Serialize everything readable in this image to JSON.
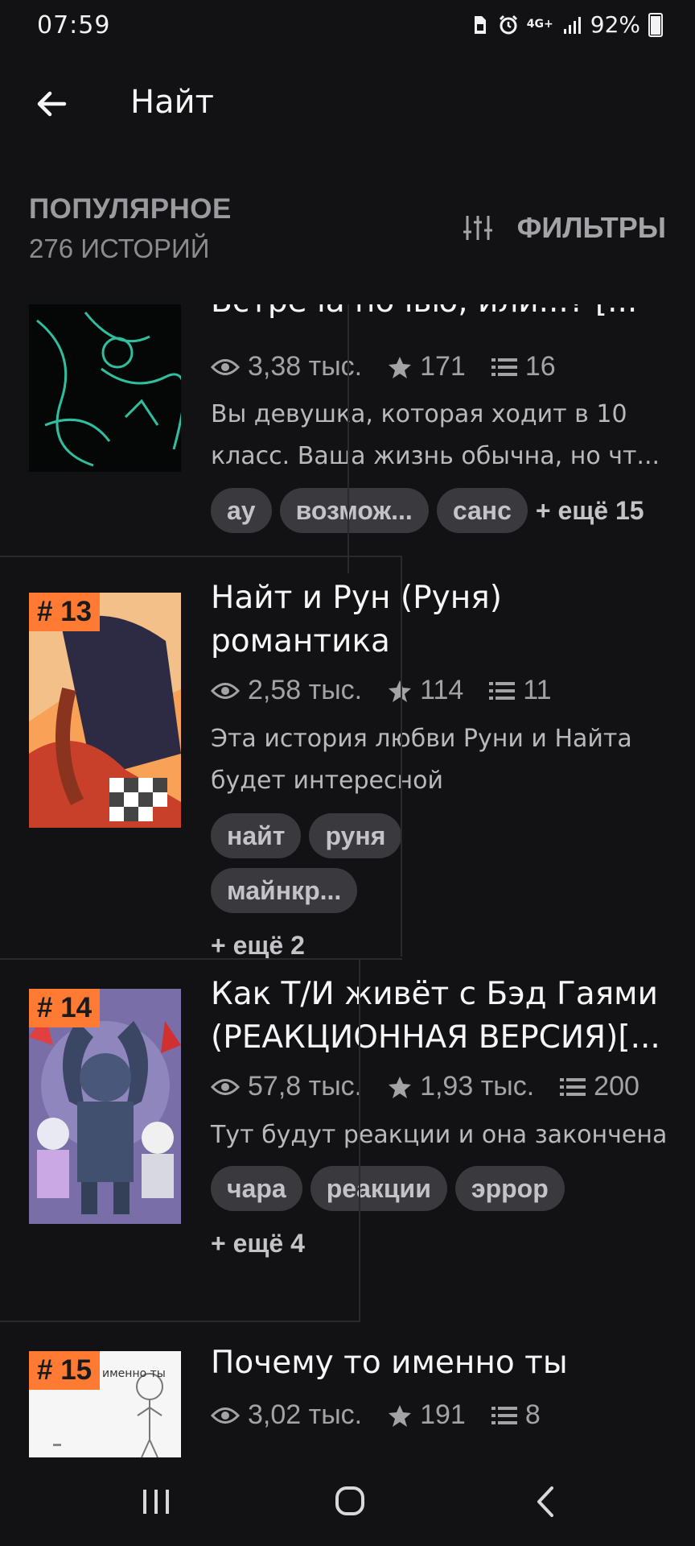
{
  "status_bar": {
    "time": "07:59",
    "network": "4G+",
    "battery": "92%",
    "icons": [
      "sim-icon",
      "alarm-icon",
      "signal-icon",
      "battery-icon"
    ]
  },
  "app_bar": {
    "title": "Найт",
    "back_icon": "arrow-left-icon"
  },
  "section": {
    "title": "ПОПУЛЯРНОЕ",
    "count": "276 ИСТОРИЙ",
    "filters_label": "ФИЛЬТРЫ",
    "filters_icon": "sliders-icon"
  },
  "stories": [
    {
      "rank": "",
      "title": "Встреча ночью, или...? [...",
      "views": "3,38 тыс.",
      "stars": "171",
      "parts": "16",
      "description": [
        "Вы девушка, которая ходит в 10",
        "класс. Ваша жизнь обычна, но чт..."
      ],
      "tags": [
        "ау",
        "возмож...",
        "санс"
      ],
      "more": "+ ещё 15"
    },
    {
      "rank": "# 13",
      "title": [
        "Найт и Рун (Руня)",
        "романтика"
      ],
      "views": "2,58 тыс.",
      "stars": "114",
      "parts": "11",
      "description": [
        "Эта история любви Руни и Найта",
        "будет интересной"
      ],
      "tags": [
        "найт",
        "руня",
        "майнкр..."
      ],
      "more": "+ ещё 2"
    },
    {
      "rank": "# 14",
      "title": [
        "Как Т/И живёт с Бэд Гаями",
        "(РЕАКЦИОННАЯ ВЕРСИЯ)[..."
      ],
      "views": "57,8 тыс.",
      "stars": "1,93 тыс.",
      "parts": "200",
      "description": [
        "Тут будут реакции и она закончена"
      ],
      "tags": [
        "чара",
        "реакции",
        "эррор"
      ],
      "more": "+ ещё 4"
    },
    {
      "rank": "# 15",
      "cover_text": "о именно ты",
      "title": "Почему то именно ты",
      "views": "3,02 тыс.",
      "stars": "191",
      "parts": "8"
    }
  ],
  "nav_bar": {
    "recents_icon": "recents-icon",
    "home_icon": "home-icon",
    "back_icon": "nav-back-icon"
  },
  "colors": {
    "background": "#121114",
    "rank_badge": "#ff7a33",
    "tag_bg": "#3a393e"
  }
}
